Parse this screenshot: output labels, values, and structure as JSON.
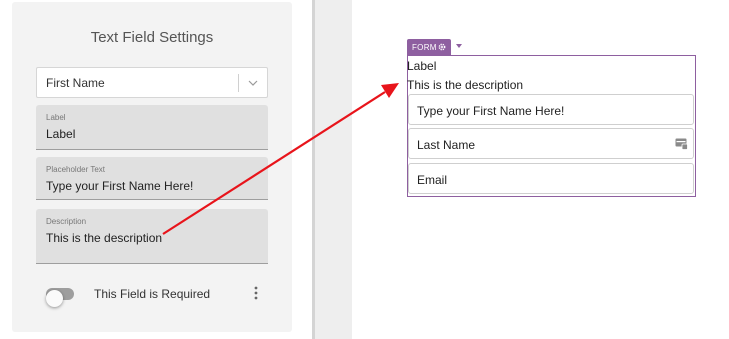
{
  "settings": {
    "title": "Text Field Settings",
    "field_select": {
      "value": "First Name"
    },
    "label_field": {
      "label": "Label",
      "value": "Label"
    },
    "placeholder_field": {
      "label": "Placeholder Text",
      "value": "Type your First Name Here!"
    },
    "description_field": {
      "label": "Description",
      "value": "This is the description"
    },
    "required_toggle": {
      "label": "This Field is Required",
      "checked": false
    }
  },
  "preview": {
    "badge": "FORM",
    "label": "Label",
    "description": "This is the description",
    "inputs": [
      {
        "text": "Type your First Name Here!"
      },
      {
        "text": "Last Name"
      },
      {
        "text": "Email"
      }
    ]
  },
  "colors": {
    "form_accent": "#8e5fa0",
    "annotation_arrow": "#e8141b",
    "panel_background": "#f3f3f3",
    "filled_field_background": "#e0e0e0"
  },
  "icons": {
    "select_chevron": "chevron-down-icon",
    "more_menu": "more-vertical-icon",
    "form_settings": "gear-icon",
    "form_dropdown": "caret-down-icon",
    "field_badge": "card-icon"
  }
}
